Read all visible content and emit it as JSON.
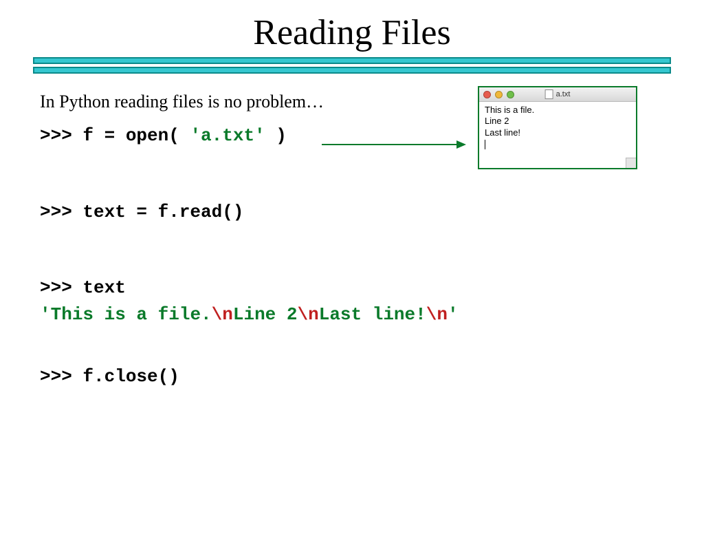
{
  "title": "Reading Files",
  "intro": "In Python reading files is no problem…",
  "code": {
    "line1_prompt": ">>> f = open( ",
    "line1_str": "'a.txt'",
    "line1_end": " )",
    "line2": ">>> text = f.read()",
    "line3": ">>> text",
    "line4_q1": "'",
    "line4_p1": "This is a file.",
    "line4_e1": "\\n",
    "line4_p2": "Line 2",
    "line4_e2": "\\n",
    "line4_p3": "Last line!",
    "line4_e3": "\\n",
    "line4_q2": "'",
    "line5": ">>> f.close()"
  },
  "window": {
    "filename": "a.txt",
    "line1": "This is a file.",
    "line2": "Line 2",
    "line3": "Last line!",
    "btn_colors": {
      "red": "#e75b4d",
      "yellow": "#f0b83a",
      "green": "#6fbf4a"
    }
  }
}
